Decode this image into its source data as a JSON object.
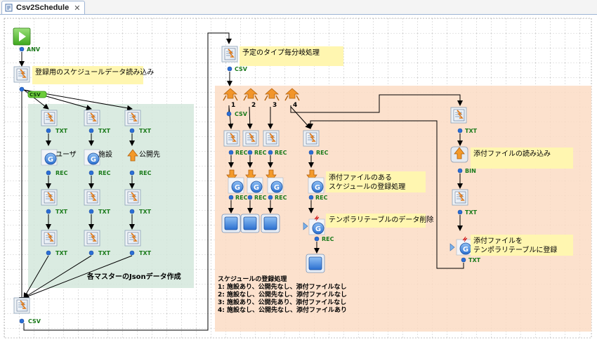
{
  "tab": {
    "title": "Csv2Schedule",
    "close_glyph": "✕",
    "icon": "flow-document-icon"
  },
  "regions": {
    "master": {
      "label": "各マスターのJsonデータ作成",
      "color": "#d4e8dc"
    },
    "schedule": {
      "label_lines": [
        "スケジュールの登録処理",
        "1: 施設あり、公開先なし、添付ファイルなし",
        "2: 施設なし、公開先なし、添付ファイルなし",
        "3: 施設あり、公開先あり、添付ファイルなし",
        "4: 施設なし、公開先なし、添付ファイルあり"
      ],
      "color": "#fcdcc4"
    }
  },
  "notes": {
    "read_schedule": "登録用のスケジュールデータ読み込み",
    "branch": "予定のタイプ毎分岐処理",
    "user": "ユーザ",
    "facility": "施設",
    "public": "公開先",
    "attach_register": [
      "添付ファイルのある",
      "スケジュールの登録処理"
    ],
    "temp_delete": "テンポラリテーブルのデータ削除",
    "read_attach": "添付ファイルの読み込み",
    "attach_temp": [
      "添付ファイルを",
      "テンポラリテーブルに登録"
    ]
  },
  "ports": {
    "any": "ANV",
    "csv": "CSV",
    "txt": "TXT",
    "rec": "REC",
    "bin": "BIN"
  },
  "branch_numbers": [
    "1",
    "2",
    "3",
    "4"
  ],
  "colors": {
    "grid": "#8a8a8a",
    "line": "#000000",
    "note": "#fff6b0",
    "port_label": "#1a7a1a",
    "port_dot": "#2a6ed6"
  }
}
